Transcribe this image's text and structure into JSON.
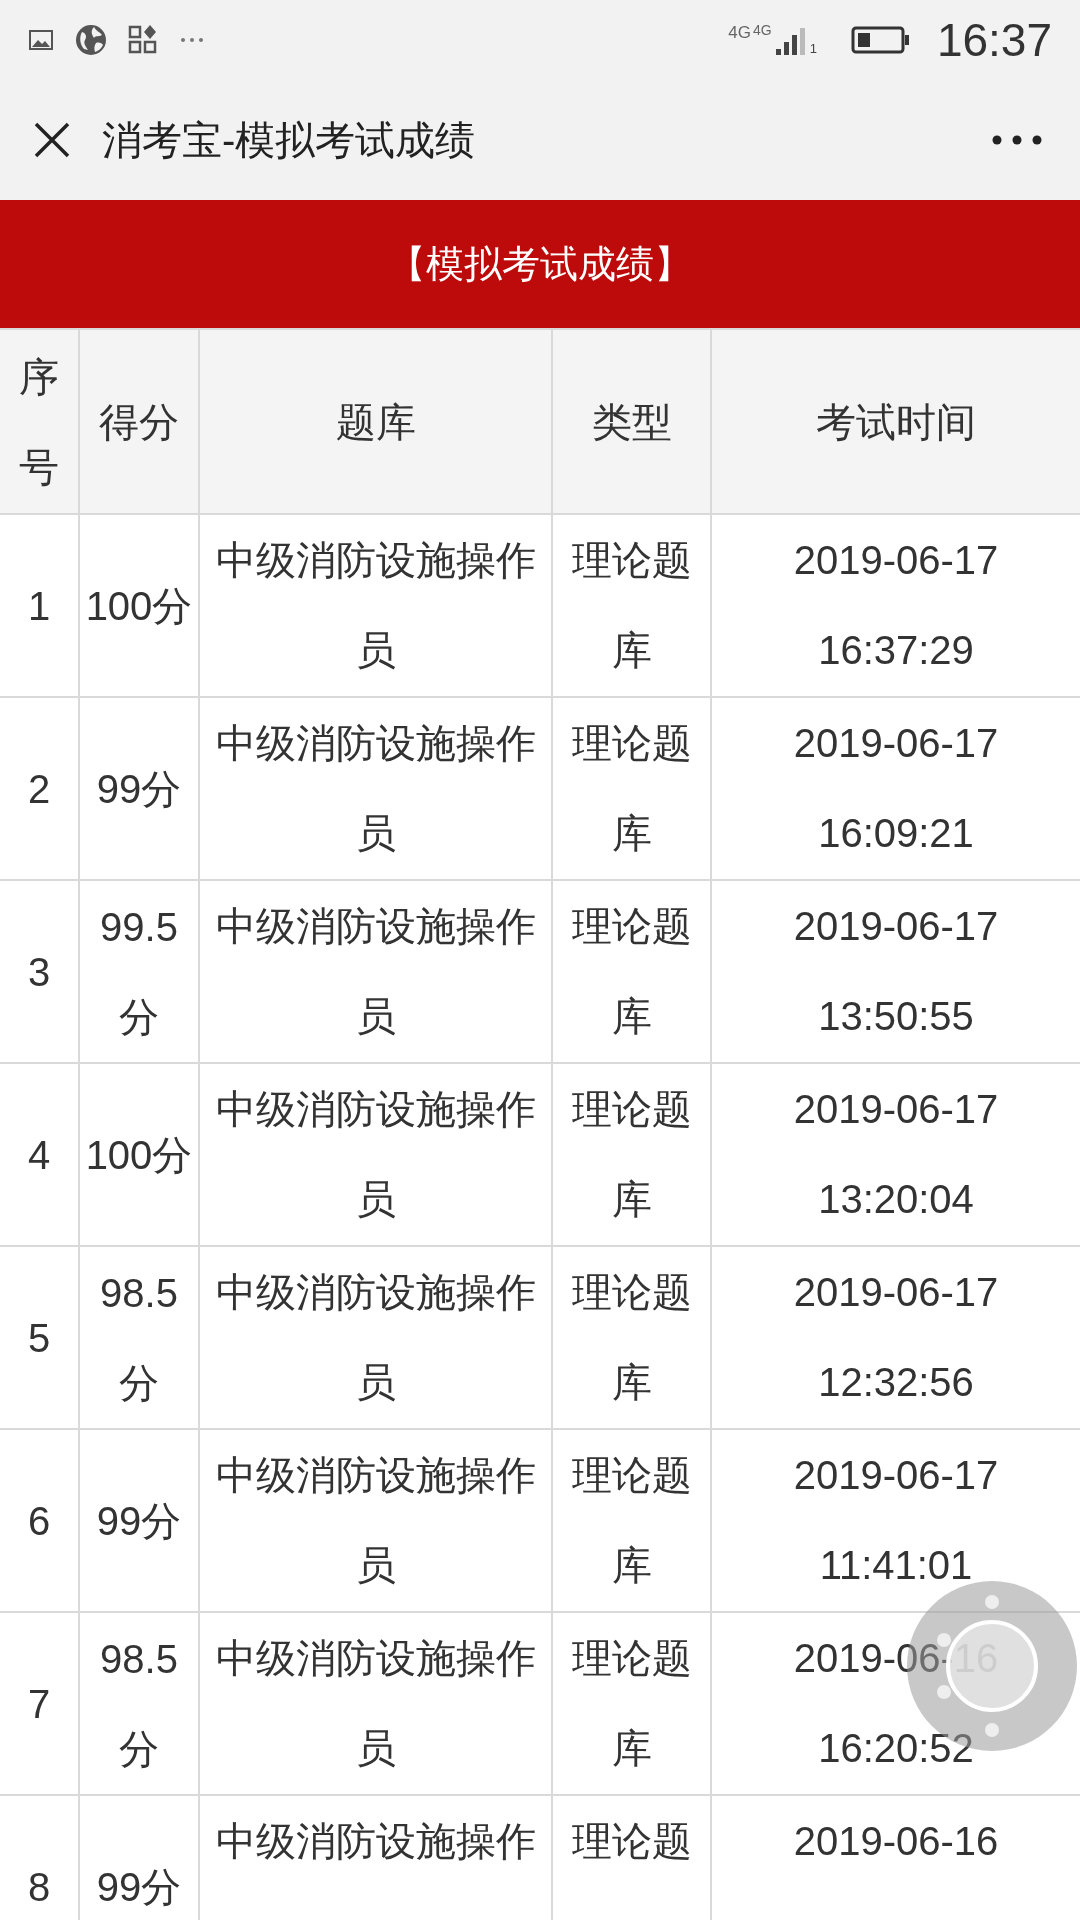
{
  "status_bar": {
    "network_labels": [
      "4G",
      "4G"
    ],
    "sim_label": "1",
    "time": "16:37"
  },
  "nav": {
    "title": "消考宝-模拟考试成绩"
  },
  "banner": {
    "title": "【模拟考试成绩】"
  },
  "table": {
    "columns": [
      "序号",
      "得分",
      "题库",
      "类型",
      "考试时间"
    ],
    "rows": [
      {
        "cells": [
          "1",
          "100分",
          "中级消防设施操作员",
          "理论题库",
          "2019-06-17 16:37:29"
        ]
      },
      {
        "cells": [
          "2",
          "99分",
          "中级消防设施操作员",
          "理论题库",
          "2019-06-17 16:09:21"
        ]
      },
      {
        "cells": [
          "3",
          "99.5分",
          "中级消防设施操作员",
          "理论题库",
          "2019-06-17 13:50:55"
        ]
      },
      {
        "cells": [
          "4",
          "100分",
          "中级消防设施操作员",
          "理论题库",
          "2019-06-17 13:20:04"
        ]
      },
      {
        "cells": [
          "5",
          "98.5分",
          "中级消防设施操作员",
          "理论题库",
          "2019-06-17 12:32:56"
        ]
      },
      {
        "cells": [
          "6",
          "99分",
          "中级消防设施操作员",
          "理论题库",
          "2019-06-17 11:41:01"
        ]
      },
      {
        "cells": [
          "7",
          "98.5分",
          "中级消防设施操作员",
          "理论题库",
          "2019-06-16 16:20:52"
        ]
      },
      {
        "cells": [
          "8",
          "99分",
          "中级消防设施操作",
          "理论题",
          "2019-06-16"
        ]
      }
    ]
  }
}
